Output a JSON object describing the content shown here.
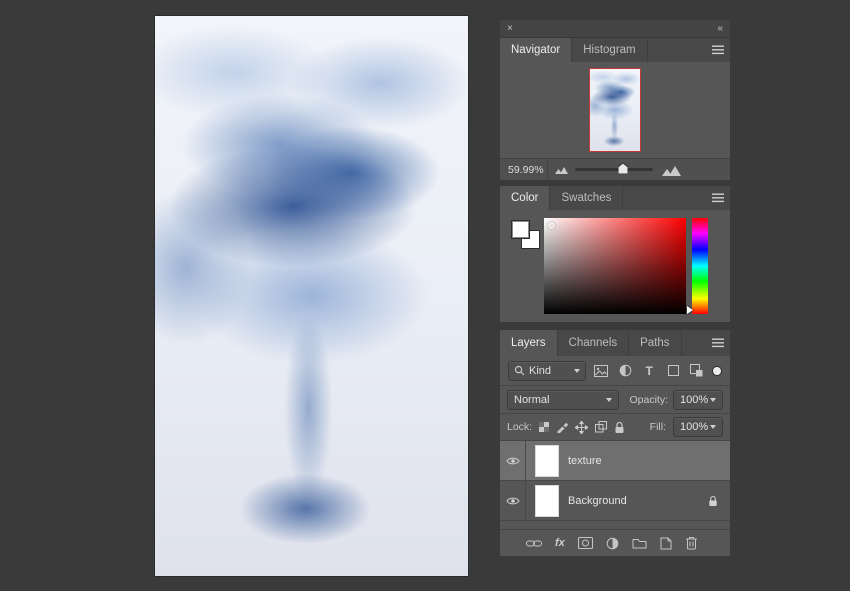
{
  "window": {
    "close_glyph": "×",
    "collapse_glyph": "«"
  },
  "navigator": {
    "tabs": [
      {
        "label": "Navigator"
      },
      {
        "label": "Histogram"
      }
    ],
    "zoom_value": "59.99%"
  },
  "color": {
    "tabs": [
      {
        "label": "Color"
      },
      {
        "label": "Swatches"
      }
    ]
  },
  "layers": {
    "tabs": [
      {
        "label": "Layers"
      },
      {
        "label": "Channels"
      },
      {
        "label": "Paths"
      }
    ],
    "filter_kind_label": "Kind",
    "blend_mode_value": "Normal",
    "opacity_label": "Opacity:",
    "opacity_value": "100%",
    "lock_label": "Lock:",
    "fill_label": "Fill:",
    "fill_value": "100%",
    "items": [
      {
        "name": "texture"
      },
      {
        "name": "Background"
      }
    ]
  },
  "icons": {
    "type_filter_glyph": "T",
    "fx_glyph": "fx"
  },
  "colors": {
    "stage_bg": "#3a3a3a",
    "panel_bg": "#565656",
    "navigator_proxy_border": "#c33a34",
    "selected_layer_bg": "#6f6f6f"
  }
}
